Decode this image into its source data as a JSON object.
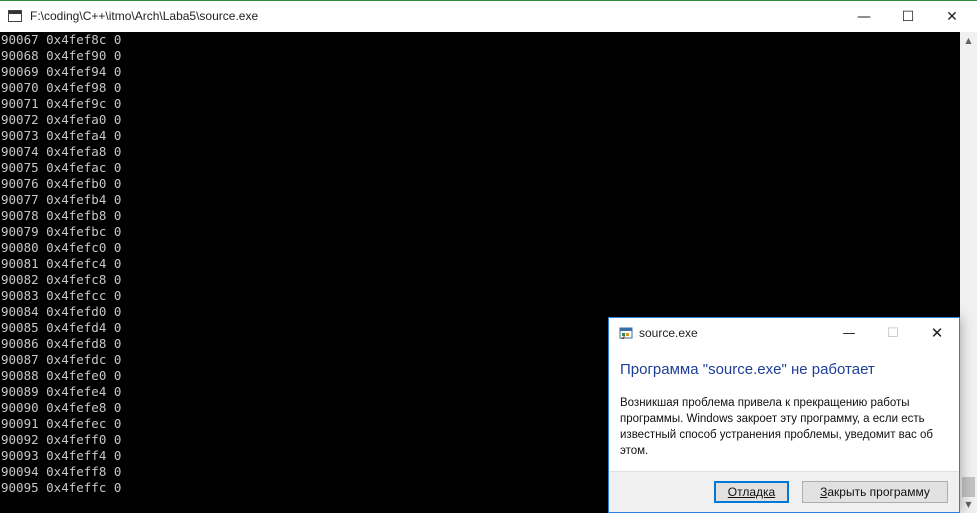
{
  "console_window": {
    "title": "F:\\coding\\C++\\itmo\\Arch\\Laba5\\source.exe",
    "minimize_glyph": "—",
    "maximize_glyph": "☐",
    "close_glyph": "✕",
    "lines": [
      "90067 0x4fef8c 0",
      "90068 0x4fef90 0",
      "90069 0x4fef94 0",
      "90070 0x4fef98 0",
      "90071 0x4fef9c 0",
      "90072 0x4fefa0 0",
      "90073 0x4fefa4 0",
      "90074 0x4fefa8 0",
      "90075 0x4fefac 0",
      "90076 0x4fefb0 0",
      "90077 0x4fefb4 0",
      "90078 0x4fefb8 0",
      "90079 0x4fefbc 0",
      "90080 0x4fefc0 0",
      "90081 0x4fefc4 0",
      "90082 0x4fefc8 0",
      "90083 0x4fefcc 0",
      "90084 0x4fefd0 0",
      "90085 0x4fefd4 0",
      "90086 0x4fefd8 0",
      "90087 0x4fefdc 0",
      "90088 0x4fefe0 0",
      "90089 0x4fefe4 0",
      "90090 0x4fefe8 0",
      "90091 0x4fefec 0",
      "90092 0x4feff0 0",
      "90093 0x4feff4 0",
      "90094 0x4feff8 0",
      "90095 0x4feffc 0"
    ],
    "scroll_up_glyph": "▲",
    "scroll_down_glyph": "▼"
  },
  "error_dialog": {
    "title": "source.exe",
    "minimize_glyph": "—",
    "maximize_glyph": "☐",
    "close_glyph": "✕",
    "heading": "Программа \"source.exe\" не работает",
    "message": "Возникшая проблема привела к прекращению работы программы. Windows закроет эту программу, а если есть известный способ устранения проблемы, уведомит вас об этом.",
    "debug_button": "Отладка",
    "close_program_button": "Закрыть программу"
  },
  "colors": {
    "console_bg": "#000000",
    "console_text": "#c8c8c8",
    "dialog_heading": "#1f3e9b",
    "dialog_border": "#2f7bd8"
  }
}
